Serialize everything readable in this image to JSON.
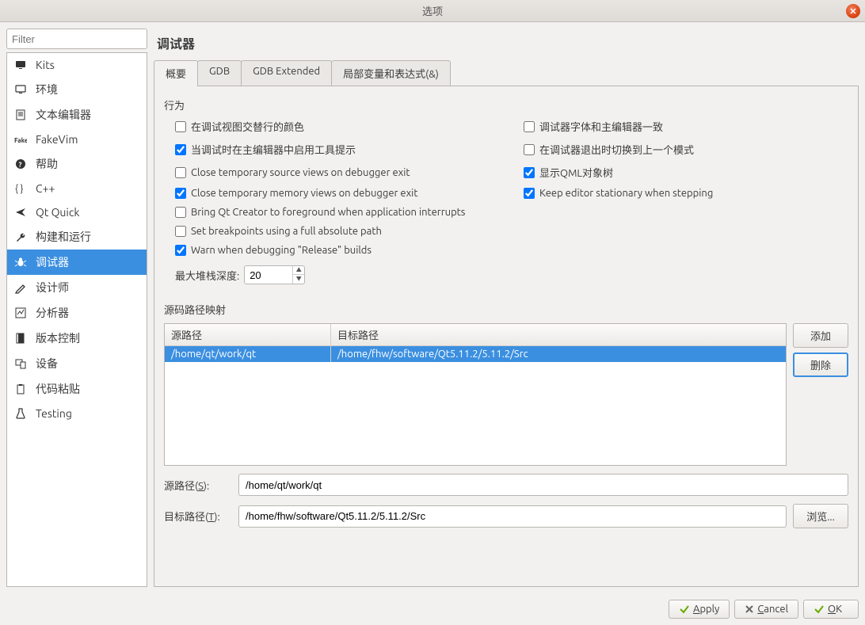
{
  "window": {
    "title": "选项"
  },
  "filter_placeholder": "Filter",
  "categories": [
    {
      "id": "kits",
      "label": "Kits",
      "icon": "monitor"
    },
    {
      "id": "env",
      "label": "环境",
      "icon": "monitor-outline"
    },
    {
      "id": "texteditor",
      "label": "文本编辑器",
      "icon": "document"
    },
    {
      "id": "fakevim",
      "label": "FakeVim",
      "icon": "fakevim"
    },
    {
      "id": "help",
      "label": "帮助",
      "icon": "question"
    },
    {
      "id": "cpp",
      "label": "C++",
      "icon": "braces"
    },
    {
      "id": "qtquick",
      "label": "Qt Quick",
      "icon": "plane"
    },
    {
      "id": "buildrun",
      "label": "构建和运行",
      "icon": "wrench"
    },
    {
      "id": "debugger",
      "label": "调试器",
      "icon": "bug",
      "selected": true
    },
    {
      "id": "designer",
      "label": "设计师",
      "icon": "pencil"
    },
    {
      "id": "analyzer",
      "label": "分析器",
      "icon": "analyzer"
    },
    {
      "id": "vcs",
      "label": "版本控制",
      "icon": "vcs"
    },
    {
      "id": "devices",
      "label": "设备",
      "icon": "devices"
    },
    {
      "id": "paster",
      "label": "代码粘贴",
      "icon": "paste"
    },
    {
      "id": "testing",
      "label": "Testing",
      "icon": "flask"
    }
  ],
  "page": {
    "title": "调试器"
  },
  "tabs": [
    "概要",
    "GDB",
    "GDB Extended",
    "局部变量和表达式(&)"
  ],
  "active_tab": 0,
  "behavior": {
    "heading": "行为",
    "checks": {
      "alt_row": {
        "label": "在调试视图交替行的颜色",
        "checked": false
      },
      "font": {
        "label": "调试器字体和主编辑器一致",
        "checked": false
      },
      "tooltip": {
        "label": "当调试时在主编辑器中启用工具提示",
        "checked": true
      },
      "switchback": {
        "label": "在调试器退出时切换到上一个模式",
        "checked": false
      },
      "close_src": {
        "label": "Close temporary source views on debugger exit",
        "checked": false
      },
      "qml_tree": {
        "label": "显示QML对象树",
        "checked": true
      },
      "close_mem": {
        "label": "Close temporary memory views on debugger exit",
        "checked": true
      },
      "stationary": {
        "label": "Keep editor stationary when stepping",
        "checked": true
      },
      "foreground": {
        "label": "Bring Qt Creator to foreground when application interrupts",
        "checked": false
      },
      "abs_bp": {
        "label": "Set breakpoints using a full absolute path",
        "checked": false
      },
      "warn_rel": {
        "label": "Warn when debugging \"Release\" builds",
        "checked": true
      }
    },
    "stack": {
      "label": "最大堆栈深度:",
      "value": "20"
    }
  },
  "mapping": {
    "heading": "源码路径映射",
    "columns": {
      "src": "源路径",
      "tgt": "目标路径"
    },
    "rows": [
      {
        "src": "/home/qt/work/qt",
        "tgt": "/home/fhw/software/Qt5.11.2/5.11.2/Src"
      }
    ],
    "add_btn": "添加",
    "del_btn": "删除",
    "src_label": "源路径(S):",
    "src_value": "/home/qt/work/qt",
    "tgt_label": "目标路径(T):",
    "tgt_value": "/home/fhw/software/Qt5.11.2/5.11.2/Src",
    "browse_btn": "浏览..."
  },
  "footer": {
    "apply": "Apply",
    "cancel": "Cancel",
    "ok": "OK"
  }
}
